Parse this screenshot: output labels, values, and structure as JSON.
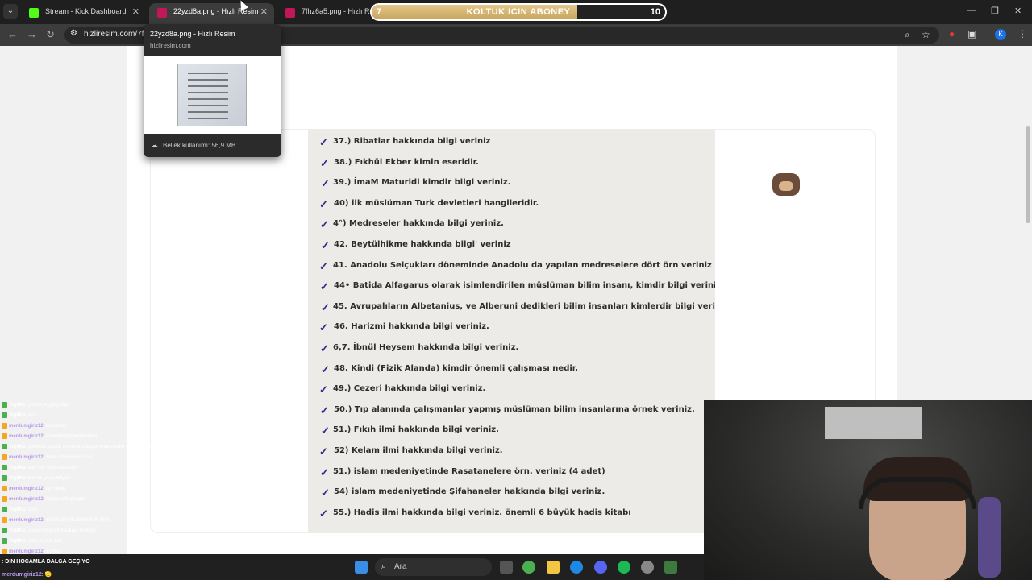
{
  "browser": {
    "tabs": [
      {
        "title": "Stream - Kick Dashboard",
        "favicon": "#53fc18"
      },
      {
        "title": "22yzd8a.png - Hızlı Resim",
        "favicon": "#c2185b"
      },
      {
        "title": "7fhz6a5.png - Hızlı Resim",
        "favicon": "#c2185b"
      }
    ],
    "url": "hizliresim.com/7fl",
    "avatar": "K",
    "sub_goal": {
      "current": "7",
      "label": "KOLTUK ICIN ABONEY",
      "target": "10",
      "progress": 0.7
    }
  },
  "tab_preview": {
    "title": "22yzd8a.png - Hızlı Resim",
    "host": "hizliresim.com",
    "memory": "Bellek kullanımı: 56,9 MB"
  },
  "paper": {
    "lines": [
      "37.) Ribatlar hakkında bilgi veriniz",
      "38.) Fıkhül Ekber kimin eseridir.",
      "39.) İmaM Maturidi kimdir bilgi veriniz.",
      "40) ilk müslüman Turk devletleri hangileridir.",
      "4°) Medreseler hakkında bilgi yeriniz.",
      "42. Beytülhikme hakkında bilgi' veriniz",
      "41. Anadolu Selçukları döneminde Anadolu da yapılan medreselere dört örn veriniz",
      "44• Batida Alfagarus olarak isimlendirilen  müslüman bilim insanı, kimdir bilgi veriniz",
      "45.  Avrupalıların Albetanius, ve Alberuni  dedikleri bilim insanları kimlerdir bilgi veriniz.",
      "46. Harizmi hakkında bilgi veriniz.",
      "6,7. İbnül Heysem hakkında bilgi veriniz.",
      "48. Kindi (Fizik Alanda) kimdir önemli çalışması nedir.",
      "49.) Cezeri hakkında bilgi veriniz.",
      "50.) Tıp alanında çalışmanlar yapmış müslüman bilim insanlarına örnek veriniz.",
      "51.) Fıkıh ilmi hakkında bilgi veriniz.",
      "52) Kelam ilmi hakkında bilgi veriniz.",
      "51.) islam medeniyetinde Rasatanelere örn. veriniz (4 adet)",
      "54)  islam medeniyetinde Şifahaneler hakkında bilgi veriniz.",
      "55.) Hadis ilmi hakkında bilgi veriniz. önemli 6 büyük hadis kitabı"
    ]
  },
  "chat": {
    "messages": [
      {
        "user": "YigitKa",
        "text": ": yüzmeye gidiyorlar",
        "color": "#ffffff"
      },
      {
        "user": "YigitKa",
        "text": ": dsfs",
        "color": "#ffffff"
      },
      {
        "user": "merdumgiriz12",
        "text": ": ko kardeş",
        "color": "#b69be8"
      },
      {
        "user": "merdumgiriz12",
        "text": ": Enerdumgitçongitmyliini",
        "color": "#b69be8"
      },
      {
        "user": "YigitKa",
        "text": ": göbkeck stealth homeland başla veya seçme siteme bildik ediceni bir",
        "color": "#ffffff"
      },
      {
        "user": "merdumgiriz12",
        "text": ": Seze etmiceni enoom",
        "color": "#b69be8"
      },
      {
        "user": "YigitKa",
        "text": ": bilgi gibi tilğünmiyorum",
        "color": "#ffffff"
      },
      {
        "user": "YigitKa",
        "text": ": bos mi yaniş biliyen",
        "color": "#ffffff"
      },
      {
        "user": "merdumgiriz12",
        "text": ": lipy urfan",
        "color": "#b69be8"
      },
      {
        "user": "merdumgiriz12",
        "text": ": fagleongitinglingitn",
        "color": "#b69be8"
      },
      {
        "user": "YigitKa",
        "text": ": sesli",
        "color": "#ffffff"
      },
      {
        "user": "merdumgiriz12",
        "text": ": SİNİRLENİRLENMENİR TERİ",
        "color": "#b69be8"
      },
      {
        "user": "YigitKa",
        "text": ": şişman bugünnebutuya kendiye",
        "color": "#ffffff"
      },
      {
        "user": "YigitKa",
        "text": ": ama ziyaret bali",
        "color": "#ffffff"
      },
      {
        "user": "merdumgiriz12",
        "text": ": Esriba",
        "color": "#b69be8"
      }
    ],
    "notification": ": DIN HOCAMLA DALGA GEÇIYO",
    "notification_user": "merdumgiriz12",
    "notification_text": ": 🫡"
  },
  "taskbar": {
    "search_placeholder": "Ara"
  }
}
